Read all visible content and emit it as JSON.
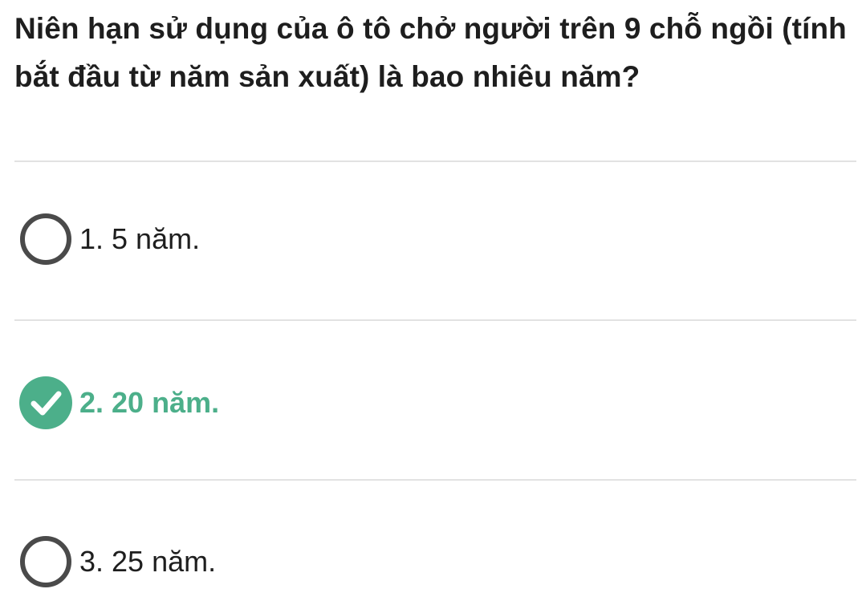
{
  "question": {
    "text": "Niên hạn sử dụng của ô tô chở người trên 9 chỗ ngồi (tính bắt đầu từ năm sản xuất) là bao nhiêu năm?"
  },
  "options": [
    {
      "label": "1. 5 năm.",
      "state": "unselected",
      "icon": "radio-empty-icon"
    },
    {
      "label": "2. 20 năm.",
      "state": "correct",
      "icon": "check-circle-icon"
    },
    {
      "label": "3. 25 năm.",
      "state": "unselected",
      "icon": "radio-empty-icon"
    }
  ],
  "colors": {
    "correct": "#4caf8a",
    "text": "#1e1e1e",
    "radio_border": "#4a4a4a",
    "divider": "#e2e2e2"
  }
}
